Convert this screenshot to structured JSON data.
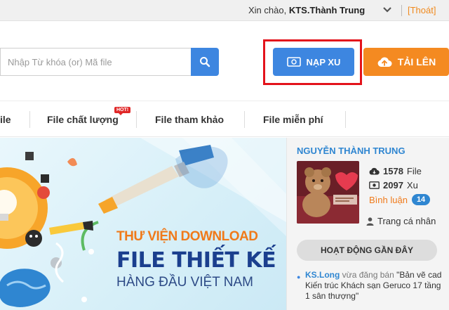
{
  "topbar": {
    "greeting": "Xin chào,",
    "username": "KTS.Thành Trung",
    "logout": "[Thoát]"
  },
  "header": {
    "search_placeholder": "Nhập Từ khóa (or) Mã file",
    "napxu_label": "NẠP XU",
    "tailen_label": "TẢI LÊN"
  },
  "nav": {
    "items": [
      {
        "label": "ile"
      },
      {
        "label": "File chất lượng"
      },
      {
        "label": "File tham khảo"
      },
      {
        "label": "File miễn phí"
      }
    ],
    "hot_badge": "HOT!"
  },
  "banner": {
    "line1": "THƯ VIỆN DOWNLOAD",
    "line2": "FILE THIẾT KẾ",
    "line3": "HÀNG ĐẦU VIỆT NAM"
  },
  "sidebar": {
    "name": "NGUYỄN THÀNH TRUNG",
    "files_count": "1578",
    "files_label": "File",
    "xu_count": "2097",
    "xu_label": "Xu",
    "comments_label": "Bình luận",
    "comments_count": "14",
    "profile_label": "Trang cá nhân",
    "activity_title": "HOẠT ĐỘNG GẦN ĐÂY",
    "activity": {
      "user": "KS.Long",
      "verb": "vừa đăng bán",
      "text": "\"Bản vẽ cad Kiến trúc Khách sạn Geruco 17 tầng 1 sân thượng\""
    }
  },
  "colors": {
    "primary_blue": "#3d86e0",
    "orange": "#f48a21",
    "highlight_red": "#e3131b",
    "link_blue": "#2f86d1"
  }
}
